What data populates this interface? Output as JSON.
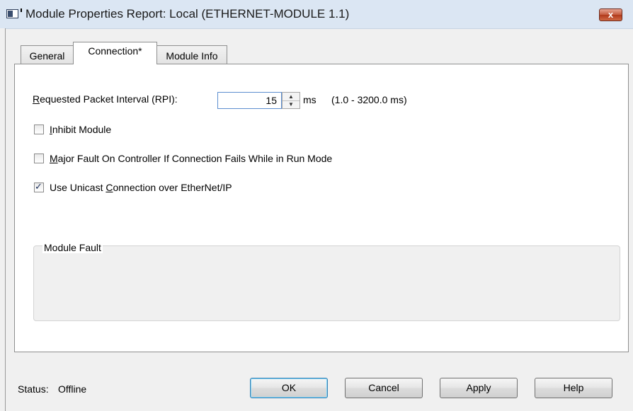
{
  "window": {
    "title": "Module Properties Report: Local (ETHERNET-MODULE 1.1)",
    "close_glyph": "x"
  },
  "tabs": [
    {
      "label": "General"
    },
    {
      "label": "Connection*"
    },
    {
      "label": "Module Info"
    }
  ],
  "rpi": {
    "label_accel": "R",
    "label_rest": "equested Packet Interval (RPI):",
    "value": "15",
    "unit": "ms",
    "range": "(1.0 - 3200.0 ms)"
  },
  "options": {
    "inhibit": {
      "accel": "I",
      "rest": "nhibit Module",
      "checked": false
    },
    "major_fault": {
      "accel": "M",
      "rest": "ajor Fault On Controller If Connection Fails While in Run Mode",
      "checked": false
    },
    "unicast": {
      "before": "Use Unicast ",
      "accel": "C",
      "rest": "onnection over EtherNet/IP",
      "checked": true
    }
  },
  "module_fault": {
    "title": "Module Fault"
  },
  "status": {
    "label": "Status:",
    "value": "Offline"
  },
  "buttons": {
    "ok": "OK",
    "cancel": "Cancel",
    "apply": "Apply",
    "help": "Help"
  }
}
